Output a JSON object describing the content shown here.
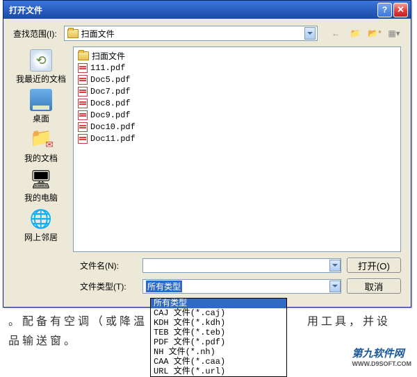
{
  "dialog": {
    "title": "打开文件",
    "look_in_label": "查找范围(I):",
    "current_folder": "扫面文件",
    "filename_label": "文件名(N):",
    "filename_value": "",
    "filetype_label": "文件类型(T):",
    "filetype_selected": "所有类型",
    "open_btn": "打开(O)",
    "cancel_btn": "取消"
  },
  "sidebar": {
    "items": [
      {
        "label": "我最近的文档"
      },
      {
        "label": "桌面"
      },
      {
        "label": "我的文档"
      },
      {
        "label": "我的电脑"
      },
      {
        "label": "网上邻居"
      }
    ]
  },
  "files": [
    {
      "name": "扫面文件",
      "type": "folder"
    },
    {
      "name": "111.pdf",
      "type": "pdf"
    },
    {
      "name": "Doc5.pdf",
      "type": "pdf"
    },
    {
      "name": "Doc7.pdf",
      "type": "pdf"
    },
    {
      "name": "Doc8.pdf",
      "type": "pdf"
    },
    {
      "name": "Doc9.pdf",
      "type": "pdf"
    },
    {
      "name": "Doc10.pdf",
      "type": "pdf"
    },
    {
      "name": "Doc11.pdf",
      "type": "pdf"
    }
  ],
  "filetypes": [
    "所有类型",
    "CAJ 文件(*.caj)",
    "KDH 文件(*.kdh)",
    "TEB 文件(*.teb)",
    "PDF 文件(*.pdf)",
    "NH 文件(*.nh)",
    "CAA 文件(*.caa)",
    "URL 文件(*.url)"
  ],
  "bg": {
    "line1": "。配备有空调（或降温",
    "line1b": "用工具，并设",
    "line2": "品输送窗。"
  },
  "watermark": {
    "main": "第九软件网",
    "sub": "WWW.D9SOFT.COM"
  }
}
